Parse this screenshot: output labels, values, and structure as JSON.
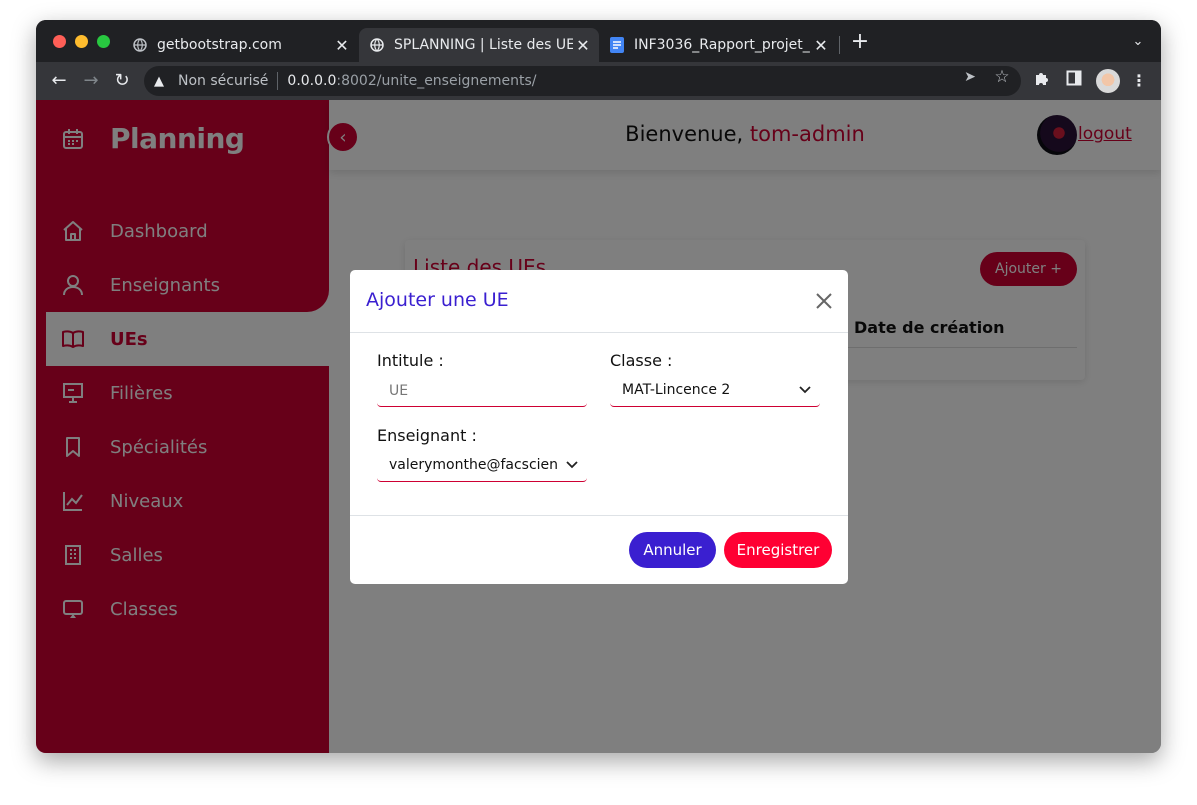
{
  "browser": {
    "tabs": [
      {
        "title": "getbootstrap.com",
        "favicon": "globe-icon"
      },
      {
        "title": "SPLANNING | Liste des UEs",
        "favicon": "globe-icon"
      },
      {
        "title": "INF3036_Rapport_projet_",
        "favicon": "docs-icon"
      }
    ],
    "address": {
      "security_label": "Non sécurisé",
      "host": "0.0.0.0",
      "path": ":8002/unite_enseignements/"
    }
  },
  "sidebar": {
    "brand": "Planning",
    "items": [
      {
        "label": "Dashboard",
        "icon": "home-icon"
      },
      {
        "label": "Enseignants",
        "icon": "user-icon"
      },
      {
        "label": "UEs",
        "icon": "book-icon"
      },
      {
        "label": "Filières",
        "icon": "presentation-icon"
      },
      {
        "label": "Spécialités",
        "icon": "bookmark-icon"
      },
      {
        "label": "Niveaux",
        "icon": "chart-line-icon"
      },
      {
        "label": "Salles",
        "icon": "building-icon"
      },
      {
        "label": "Classes",
        "icon": "screen-icon"
      }
    ],
    "active_index": 2
  },
  "header": {
    "welcome_prefix": "Bienvenue, ",
    "username": "tom-admin",
    "logout": "logout"
  },
  "content": {
    "card_title": "Liste des UEs",
    "add_button": "Ajouter +",
    "column_date": "Date de création"
  },
  "modal": {
    "title": "Ajouter une UE",
    "intitule_label": "Intitule :",
    "intitule_placeholder": "UE",
    "classe_label": "Classe :",
    "classe_value": "MAT-Lincence 2",
    "enseignant_label": "Enseignant :",
    "enseignant_value": "valerymonthe@facsciences.cm",
    "cancel": "Annuler",
    "save": "Enregistrer"
  },
  "colors": {
    "primary": "#ce0033",
    "accent_blue": "#3a1fd0",
    "save_red": "#ff0033"
  }
}
